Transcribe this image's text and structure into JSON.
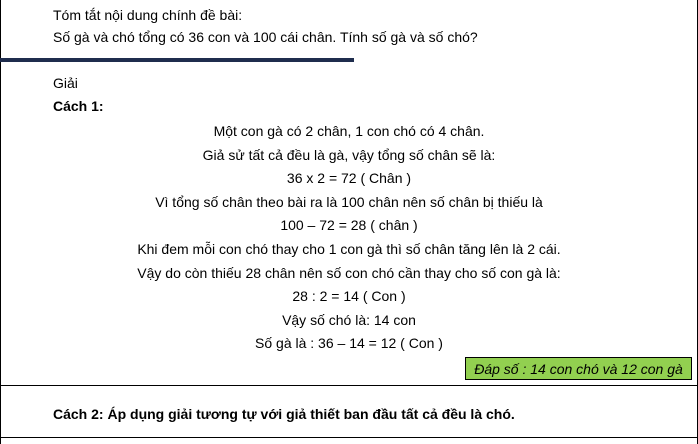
{
  "header": {
    "line1": "Tóm tắt nội dung chính đề bài:",
    "line2": "Số gà và chó tổng có 36 con và 100 cái chân. Tính số gà và số chó?"
  },
  "solution": {
    "heading": "Giải",
    "method1_title": "Cách 1:",
    "lines": [
      "Một con gà có 2 chân, 1 con chó có 4 chân.",
      "Giả sử tất cả đều là gà, vậy tổng số chân sẽ là:",
      "36 x 2 = 72 ( Chân )",
      "Vì tổng số chân theo bài ra là 100 chân nên số chân bị thiếu là",
      "100 – 72 = 28 ( chân )",
      "Khi đem mỗi con chó thay cho 1 con gà thì số chân tăng lên là 2 cái.",
      "Vậy do còn thiếu 28 chân nên số con chó cần thay cho số con gà là:",
      "28 : 2 = 14 ( Con )",
      "Vậy số chó là: 14 con",
      "Số gà là : 36 – 14 = 12 ( Con )"
    ],
    "answer": "Đáp số : 14 con chó và 12 con gà",
    "method2": "Cách 2: Áp dụng giải tương tự với giả thiết ban đầu tất cả đều là chó."
  },
  "colors": {
    "answer_background": "#92d050",
    "rule_color": "#1f2d4d"
  }
}
